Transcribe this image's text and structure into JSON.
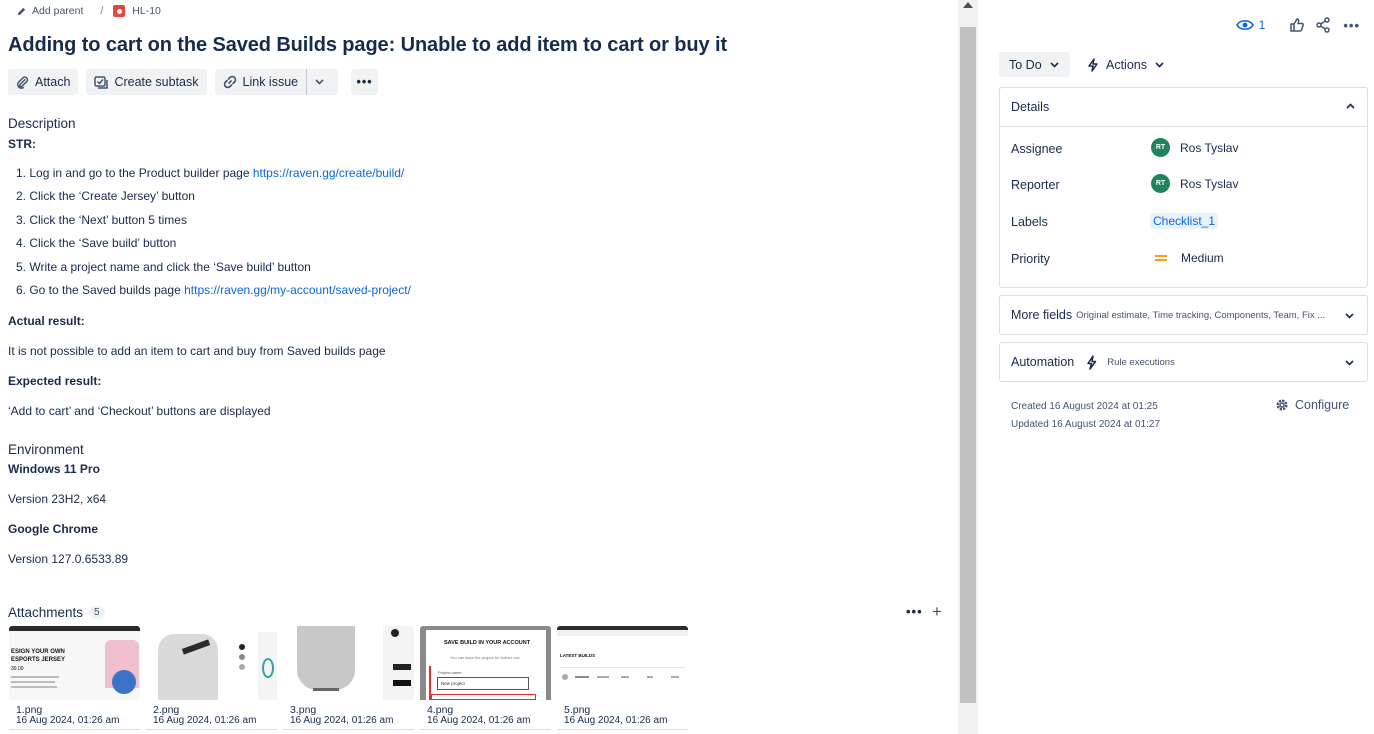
{
  "breadcrumb": {
    "add_parent": "Add parent",
    "separator": "/",
    "issue_key": "HL-10"
  },
  "issue": {
    "title": "Adding to cart on the Saved Builds page: Unable to add item to cart or buy it"
  },
  "toolbar": {
    "attach": "Attach",
    "create_subtask": "Create subtask",
    "link_issue": "Link issue",
    "more": "•••"
  },
  "description": {
    "heading": "Description",
    "str_label": "STR:",
    "steps": [
      {
        "text": "1. Log in and go to the Product builder page ",
        "link": "https://raven.gg/create/build/"
      },
      {
        "text": "2. Click the ‘Create Jersey’ button",
        "link": ""
      },
      {
        "text": "3. Click the ‘Next’ button 5 times",
        "link": ""
      },
      {
        "text": "4. Click the ‘Save build’ button",
        "link": ""
      },
      {
        "text": "5. Write a project name and click the ‘Save build’ button",
        "link": ""
      },
      {
        "text": "6. Go to the Saved builds page ",
        "link": "https://raven.gg/my-account/saved-project/"
      }
    ],
    "actual_label": "Actual result:",
    "actual_text": "It is not possible to add an item to cart and buy from Saved builds page",
    "expected_label": "Expected result:",
    "expected_text": "‘Add to cart’ and ‘Checkout’ buttons are displayed"
  },
  "environment": {
    "heading": "Environment",
    "os": "Windows 11 Pro",
    "os_version": "Version 23H2, x64",
    "browser": "Google Chrome",
    "browser_version": "Version 127.0.6533.89"
  },
  "attachments": {
    "heading": "Attachments",
    "count": "5",
    "more": "•••",
    "add": "+",
    "items": [
      {
        "name": "1.png",
        "date": "16 Aug 2024, 01:26 am"
      },
      {
        "name": "2.png",
        "date": "16 Aug 2024, 01:26 am"
      },
      {
        "name": "3.png",
        "date": "16 Aug 2024, 01:26 am"
      },
      {
        "name": "4.png",
        "date": "16 Aug 2024, 01:26 am"
      },
      {
        "name": "5.png",
        "date": "16 Aug 2024, 01:26 am"
      }
    ],
    "thumb_text": {
      "t1_line1": "ESIGN YOUR OWN",
      "t1_line2": "ESPORTS JERSEY",
      "t1_price": "39.00",
      "t4_title": "SAVE BUILD IN YOUR ACCOUNT",
      "t4_sub": "You can save the project for further use",
      "t4_field_label": "Project name",
      "t4_field_value": "New project",
      "t5_title": "LATEST BUILDS"
    }
  },
  "top_actions": {
    "watchers": "1",
    "more": "•••"
  },
  "status": {
    "label": "To Do"
  },
  "actions": {
    "label": "Actions"
  },
  "details": {
    "heading": "Details",
    "assignee_label": "Assignee",
    "assignee_initials": "RT",
    "assignee_name": "Ros Tyslav",
    "reporter_label": "Reporter",
    "reporter_initials": "RT",
    "reporter_name": "Ros Tyslav",
    "labels_label": "Labels",
    "labels_value": "Checklist_1",
    "priority_label": "Priority",
    "priority_value": "Medium"
  },
  "more_fields": {
    "label": "More fields",
    "summary": "Original estimate, Time tracking, Components, Team, Fix ..."
  },
  "automation": {
    "label": "Automation",
    "summary": "Rule executions"
  },
  "meta": {
    "created": "Created 16 August 2024 at 01:25",
    "updated": "Updated 16 August 2024 at 01:27"
  },
  "configure": {
    "label": "Configure"
  },
  "colors": {
    "link": "#0c66e4",
    "avatar": "#1f845a",
    "priority_medium": "#f8a01c",
    "issue_type": "#e2483d"
  }
}
